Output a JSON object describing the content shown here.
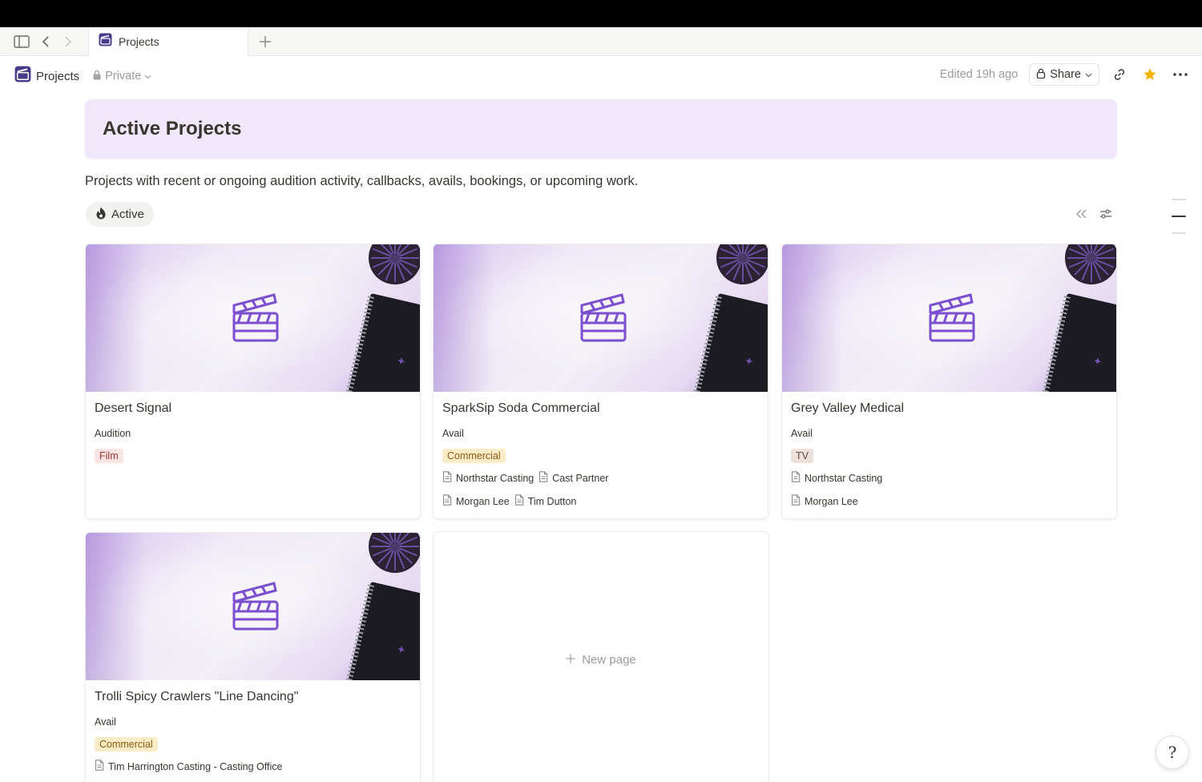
{
  "tabbar": {
    "tab_label": "Projects",
    "icons": [
      "sidebar-toggle-icon",
      "back-arrow-icon",
      "forward-arrow-icon",
      "plus-icon"
    ]
  },
  "pagebar": {
    "title": "Projects",
    "privacy": "Private",
    "edited": "Edited 19h ago",
    "share_label": "Share"
  },
  "header": {
    "title": "Active Projects",
    "description": "Projects with recent or ongoing audition activity, callbacks, avails, bookings, or upcoming work."
  },
  "view": {
    "tab_label": "Active",
    "tab_icon": "fire-icon"
  },
  "cards": [
    {
      "title": "Desert Signal",
      "status": "Audition",
      "tag": "Film",
      "relations": []
    },
    {
      "title": "SparkSip Soda Commercial",
      "status": "Avail",
      "tag": "Commercial",
      "relations": [
        [
          "Northstar Casting",
          "Cast Partner"
        ],
        [
          "Morgan Lee",
          "Tim Dutton"
        ]
      ]
    },
    {
      "title": "Grey Valley Medical",
      "status": "Avail",
      "tag": "TV",
      "relations": [
        [
          "Northstar Casting"
        ],
        [
          "Morgan Lee"
        ]
      ]
    },
    {
      "title": "Trolli Spicy Crawlers \"Line Dancing\"",
      "status": "Avail",
      "tag": "Commercial",
      "relations": [
        [
          "Tim Harrington Casting - Casting Office"
        ]
      ]
    }
  ],
  "new_page_label": "New page",
  "help_glyph": "?",
  "colors": {
    "callout_bg": "#f0e8fa",
    "accent_purple": "#7b4fd0",
    "star": "#f5b400",
    "tag_film": "#fbe4e4",
    "tag_commercial": "#fbecc8",
    "tag_tv": "#eee0da"
  }
}
